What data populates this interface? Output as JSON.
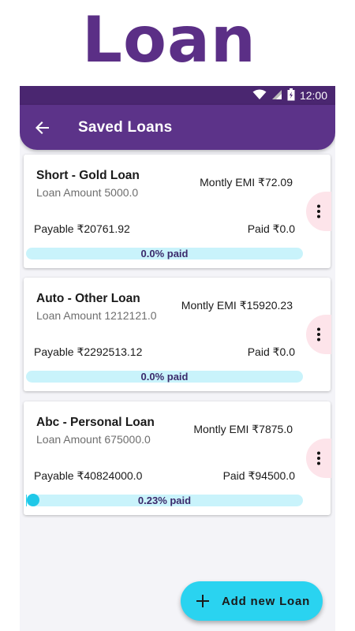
{
  "banner": {
    "title": "Loan"
  },
  "status_bar": {
    "time": "12:00",
    "icons": [
      "wifi-icon",
      "signal-icon",
      "battery-icon"
    ]
  },
  "app_bar": {
    "title": "Saved Loans",
    "back_icon": "arrow-back-icon"
  },
  "loans": [
    {
      "name": "Short - Gold Loan",
      "amount": "Loan Amount 5000.0",
      "emi": "Montly EMI ₹72.09",
      "payable": "Payable ₹20761.92",
      "paid": "Paid ₹0.0",
      "progress_label": "0.0% paid",
      "progress_fraction": 0.0
    },
    {
      "name": "Auto - Other Loan",
      "amount": "Loan Amount 1212121.0",
      "emi": "Montly EMI ₹15920.23",
      "payable": "Payable ₹2292513.12",
      "paid": "Paid ₹0.0",
      "progress_label": "0.0% paid",
      "progress_fraction": 0.0
    },
    {
      "name": "Abc - Personal Loan",
      "amount": "Loan Amount 675000.0",
      "emi": "Montly EMI ₹7875.0",
      "payable": "Payable ₹40824000.0",
      "paid": "Paid ₹94500.0",
      "progress_label": "0.23% paid",
      "progress_fraction": 0.0023
    }
  ],
  "fab": {
    "label": "Add new Loan",
    "icon": "plus-icon"
  },
  "colors": {
    "primary": "#5c3389",
    "status_bar": "#4a2670",
    "accent": "#2ad3f0",
    "progress_track": "#c9f3fb",
    "menu_bg": "#fde4ea"
  }
}
